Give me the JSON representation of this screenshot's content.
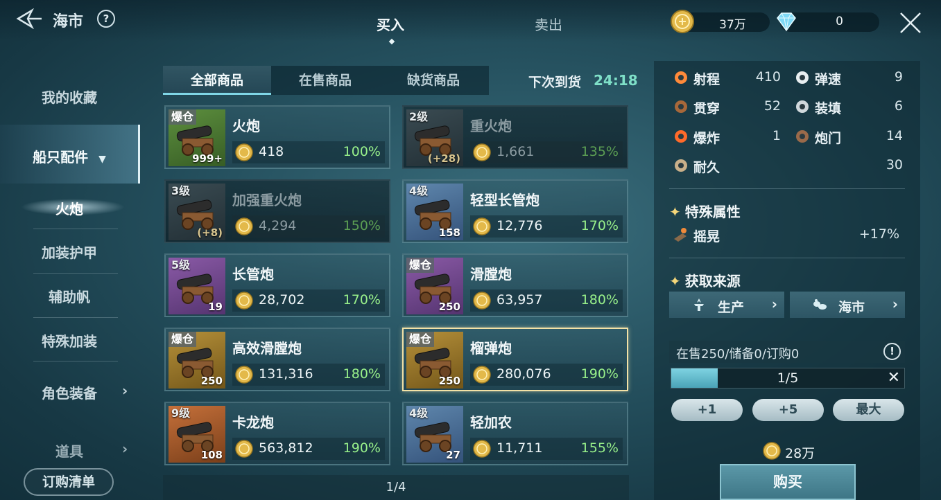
{
  "header": {
    "title": "海市",
    "help_label": "?",
    "tabs": [
      {
        "label": "买入"
      },
      {
        "label": "卖出"
      }
    ],
    "gold": "37万",
    "gems": "0"
  },
  "sidebar": {
    "items": [
      {
        "label": "我的收藏"
      },
      {
        "label": "船只配件"
      },
      {
        "label": "火炮"
      },
      {
        "label": "加装护甲"
      },
      {
        "label": "辅助帆"
      },
      {
        "label": "特殊加装"
      },
      {
        "label": "角色装备"
      },
      {
        "label": "道具"
      }
    ],
    "order_list_label": "订购清单"
  },
  "filters": {
    "tabs": [
      {
        "label": "全部商品"
      },
      {
        "label": "在售商品"
      },
      {
        "label": "缺货商品"
      }
    ],
    "restock_label": "下次到货",
    "restock_time": "24:18"
  },
  "items": [
    {
      "tag": "爆仓",
      "name": "火炮",
      "price": "418",
      "pct": "100%",
      "count": "999+",
      "rarity": "green"
    },
    {
      "tag": "2级",
      "name": "重火炮",
      "price": "1,661",
      "pct": "135%",
      "count": "(+28)",
      "rarity": "gray"
    },
    {
      "tag": "3级",
      "name": "加强重火炮",
      "price": "4,294",
      "pct": "150%",
      "count": "(+8)",
      "rarity": "gray"
    },
    {
      "tag": "4级",
      "name": "轻型长管炮",
      "price": "12,776",
      "pct": "170%",
      "count": "158",
      "rarity": "blue"
    },
    {
      "tag": "5级",
      "name": "长管炮",
      "price": "28,702",
      "pct": "170%",
      "count": "19",
      "rarity": "purple"
    },
    {
      "tag": "爆仓",
      "name": "滑膛炮",
      "price": "63,957",
      "pct": "180%",
      "count": "250",
      "rarity": "purple"
    },
    {
      "tag": "爆仓",
      "name": "高效滑膛炮",
      "price": "131,316",
      "pct": "180%",
      "count": "250",
      "rarity": "gold"
    },
    {
      "tag": "爆仓",
      "name": "榴弹炮",
      "price": "280,076",
      "pct": "190%",
      "count": "250",
      "rarity": "gold"
    },
    {
      "tag": "9级",
      "name": "卡龙炮",
      "price": "563,812",
      "pct": "190%",
      "count": "108",
      "rarity": "orange"
    },
    {
      "tag": "4级",
      "name": "轻加农",
      "price": "11,711",
      "pct": "155%",
      "count": "27",
      "rarity": "blue"
    }
  ],
  "pagination": "1/4",
  "details": {
    "stats": [
      {
        "label": "射程",
        "value": "410",
        "icon": "range-icon"
      },
      {
        "label": "弹速",
        "value": "9",
        "icon": "speed-icon"
      },
      {
        "label": "贯穿",
        "value": "52",
        "icon": "pierce-icon"
      },
      {
        "label": "装填",
        "value": "6",
        "icon": "reload-icon"
      },
      {
        "label": "爆炸",
        "value": "1",
        "icon": "explosion-icon"
      },
      {
        "label": "炮门",
        "value": "14",
        "icon": "gunport-icon"
      },
      {
        "label": "耐久",
        "value": "30",
        "icon": "durability-icon"
      }
    ],
    "special_title": "特殊属性",
    "special": {
      "label": "摇晃",
      "value": "+17%"
    },
    "source_title": "获取来源",
    "sources": [
      {
        "label": "生产"
      },
      {
        "label": "海市"
      }
    ],
    "stock_text": "在售250/储备0/订购0",
    "quantity": "1/5",
    "quantity_fraction": 0.2,
    "qty_buttons": [
      {
        "label": "+1"
      },
      {
        "label": "+5"
      },
      {
        "label": "最大"
      }
    ],
    "total": "28万",
    "buy_label": "购买"
  }
}
